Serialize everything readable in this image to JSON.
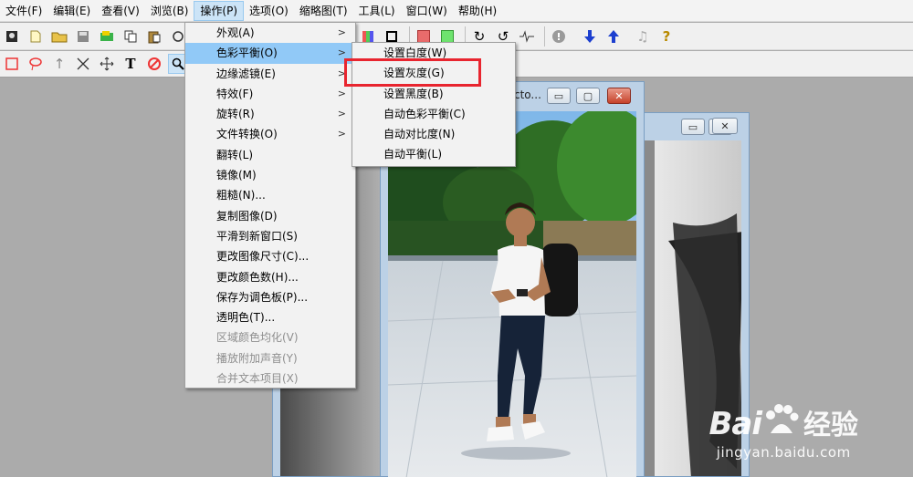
{
  "menubar": {
    "items": [
      "文件(F)",
      "编辑(E)",
      "查看(V)",
      "浏览(B)",
      "操作(P)",
      "选项(O)",
      "缩略图(T)",
      "工具(L)",
      "窗口(W)",
      "帮助(H)"
    ],
    "active_index": 4
  },
  "main_menu": {
    "items": [
      {
        "label": "外观(A)",
        "submenu": true
      },
      {
        "label": "色彩平衡(O)",
        "submenu": true,
        "highlighted": true
      },
      {
        "label": "边缘滤镜(E)",
        "submenu": true
      },
      {
        "label": "特效(F)",
        "submenu": true
      },
      {
        "label": "旋转(R)",
        "submenu": true
      },
      {
        "label": "文件转换(O)",
        "submenu": true
      },
      {
        "label": "翻转(L)"
      },
      {
        "label": "镜像(M)"
      },
      {
        "label": "粗糙(N)..."
      },
      {
        "label": "复制图像(D)"
      },
      {
        "label": "平滑到新窗口(S)"
      },
      {
        "label": "更改图像尺寸(C)..."
      },
      {
        "label": "更改颜色数(H)..."
      },
      {
        "label": "保存为调色板(P)..."
      },
      {
        "label": "透明色(T)..."
      },
      {
        "label": "区域颜色均化(V)",
        "disabled": true
      },
      {
        "label": "播放附加声音(Y)",
        "disabled": true
      },
      {
        "label": "合并文本项目(X)",
        "disabled": true
      }
    ]
  },
  "color_balance_submenu": {
    "items": [
      "设置白度(W)",
      "设置灰度(G)",
      "设置黑度(B)",
      "自动色彩平衡(C)",
      "自动对比度(N)",
      "自动平衡(L)"
    ],
    "boxed_index": 1
  },
  "front_window": {
    "title_fragment": "cto..."
  },
  "colors": {
    "highlight": "#91c9f7",
    "annotation_box": "#e8252f",
    "app_background": "#ababab"
  },
  "watermark": {
    "logo_text": "Bai",
    "logo_suffix": "经验",
    "url": "jingyan.baidu.com"
  }
}
